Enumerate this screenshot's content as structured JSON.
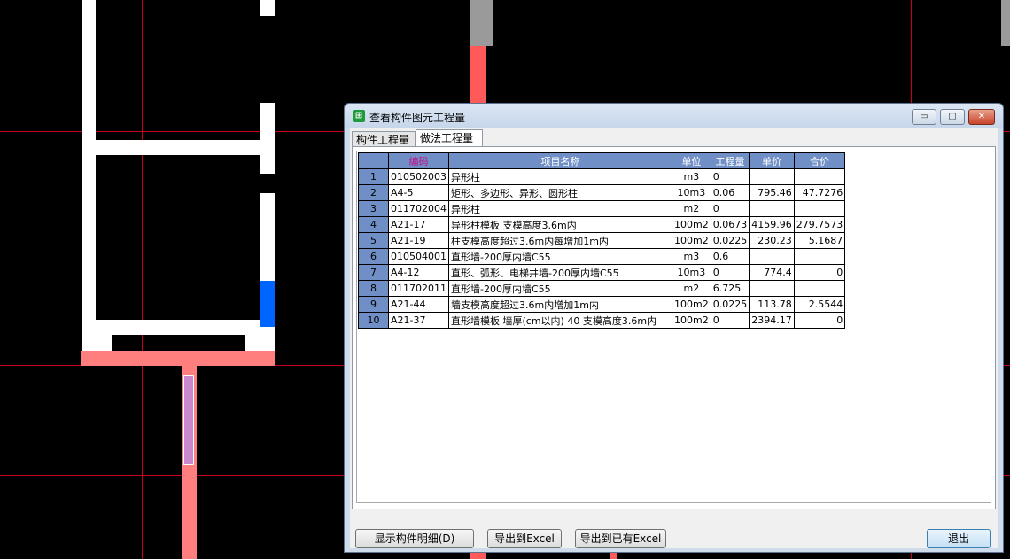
{
  "window": {
    "title": "查看构件图元工程量",
    "minimize_glyph": "▭",
    "maximize_glyph": "▢",
    "close_glyph": "✕",
    "icon": "grid-app-icon"
  },
  "tabs": [
    {
      "label": "构件工程量",
      "active": false
    },
    {
      "label": "做法工程量",
      "active": true
    }
  ],
  "table": {
    "headers": [
      "编码",
      "项目名称",
      "单位",
      "工程量",
      "单价",
      "合价"
    ],
    "rows": [
      {
        "num": "1",
        "code": "010502003",
        "name": "异形柱",
        "unit": "m3",
        "qty": "0",
        "price": "",
        "total": ""
      },
      {
        "num": "2",
        "code": "A4-5",
        "name": "矩形、多边形、异形、圆形柱",
        "unit": "10m3",
        "qty": "0.06",
        "price": "795.46",
        "total": "47.7276"
      },
      {
        "num": "3",
        "code": "011702004",
        "name": "异形柱",
        "unit": "m2",
        "qty": "0",
        "price": "",
        "total": ""
      },
      {
        "num": "4",
        "code": "A21-17",
        "name": "异形柱模板 支模高度3.6m内",
        "unit": "100m2",
        "qty": "0.0673",
        "price": "4159.96",
        "total": "279.7573"
      },
      {
        "num": "5",
        "code": "A21-19",
        "name": "柱支模高度超过3.6m内每增加1m内",
        "unit": "100m2",
        "qty": "0.0225",
        "price": "230.23",
        "total": "5.1687"
      },
      {
        "num": "6",
        "code": "010504001",
        "name": "直形墙-200厚内墙C55",
        "unit": "m3",
        "qty": "0.6",
        "price": "",
        "total": ""
      },
      {
        "num": "7",
        "code": "A4-12",
        "name": "直形、弧形、电梯井墙-200厚内墙C55",
        "unit": "10m3",
        "qty": "0",
        "price": "774.4",
        "total": "0"
      },
      {
        "num": "8",
        "code": "011702011",
        "name": "直形墙-200厚内墙C55",
        "unit": "m2",
        "qty": "6.725",
        "price": "",
        "total": ""
      },
      {
        "num": "9",
        "code": "A21-44",
        "name": "墙支模高度超过3.6m内增加1m内",
        "unit": "100m2",
        "qty": "0.0225",
        "price": "113.78",
        "total": "2.5544"
      },
      {
        "num": "10",
        "code": "A21-37",
        "name": "直形墙模板 墙厚(cm以内) 40 支模高度3.6m内",
        "unit": "100m2",
        "qty": "0",
        "price": "2394.17",
        "total": "0"
      }
    ]
  },
  "buttons": {
    "show_detail": "显示构件明细(D)",
    "export_excel": "导出到Excel",
    "export_existing_excel": "导出到已有Excel",
    "exit": "退出"
  },
  "colors": {
    "cad_background": "#000000",
    "wall_white": "#ffffff",
    "gridline_red": "#c8001e",
    "column_salmon": "#ff7f7f",
    "element_blue": "#0064ff",
    "element_gray": "#9a9a9a",
    "selected_magenta": "#cc88cc",
    "table_header": "#6f8fc6"
  }
}
